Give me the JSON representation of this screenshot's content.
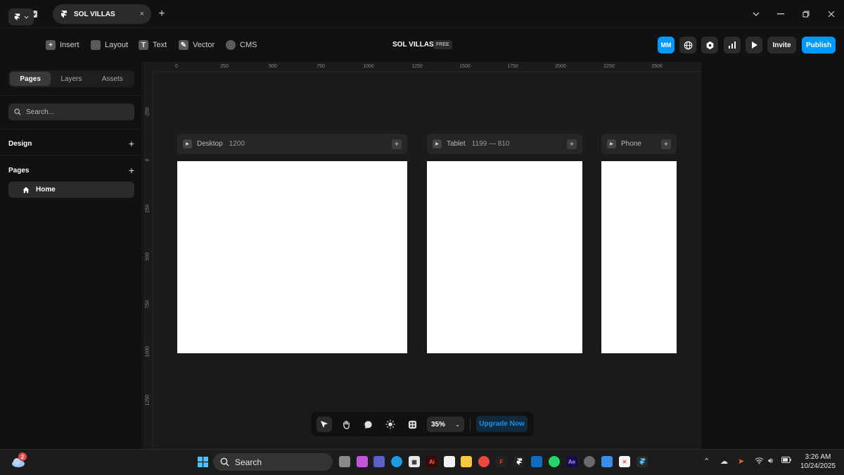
{
  "titlebar": {
    "tab_title": "SOL VILLAS",
    "tab_close": "×",
    "new_tab": "+"
  },
  "toolbar": {
    "insert": "Insert",
    "layout": "Layout",
    "text": "Text",
    "vector": "Vector",
    "cms": "CMS",
    "project_title": "SOL VILLAS",
    "plan_badge": "FREE",
    "avatar_initials": "MM",
    "invite": "Invite",
    "publish": "Publish"
  },
  "left_panel": {
    "tabs": [
      {
        "label": "Pages",
        "active": true
      },
      {
        "label": "Layers",
        "active": false
      },
      {
        "label": "Assets",
        "active": false
      }
    ],
    "search_placeholder": "Search...",
    "design_heading": "Design",
    "pages_heading": "Pages",
    "pages": [
      {
        "label": "Home",
        "icon": "home-icon"
      }
    ]
  },
  "rulers": {
    "x_ticks": [
      "0",
      "250",
      "500",
      "750",
      "1000",
      "1250",
      "1500",
      "1750",
      "2000",
      "2250",
      "2500"
    ],
    "y_ticks": [
      "-250",
      "0",
      "250",
      "500",
      "750",
      "1000",
      "1250"
    ]
  },
  "frames": [
    {
      "name": "Desktop",
      "size": "1200"
    },
    {
      "name": "Tablet",
      "size": "1199 — 810"
    },
    {
      "name": "Phone",
      "size": ""
    }
  ],
  "bottom_tools": {
    "zoom": "35%",
    "upgrade": "Upgrade Now"
  },
  "taskbar": {
    "search": "Search",
    "time": "3:26 AM",
    "date": "10/24/2025",
    "weather_badge": "2"
  },
  "colors": {
    "accent": "#0099ff",
    "canvas": "#1b1b1b",
    "panel": "#111111"
  }
}
